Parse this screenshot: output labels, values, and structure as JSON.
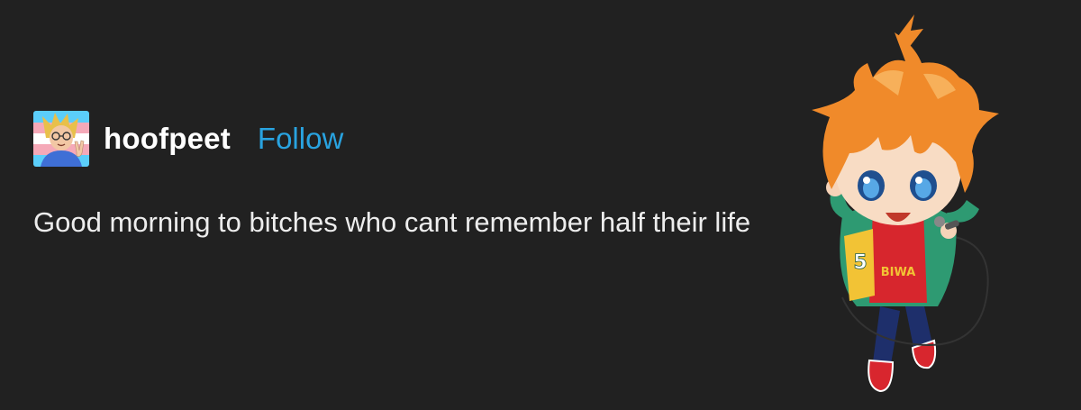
{
  "post": {
    "author": {
      "username": "hoofpeet",
      "follow_label": "Follow",
      "avatar_icon": "user-avatar-icon"
    },
    "body_text": "Good morning to bitches who cant remember half their life"
  },
  "illustration": {
    "icon": "chibi-character-sticker-icon",
    "jacket_number": "5",
    "shirt_text": "BIWA"
  },
  "colors": {
    "background": "#212121",
    "username": "#ffffff",
    "follow": "#29a3e0",
    "body_text": "#ededed"
  }
}
